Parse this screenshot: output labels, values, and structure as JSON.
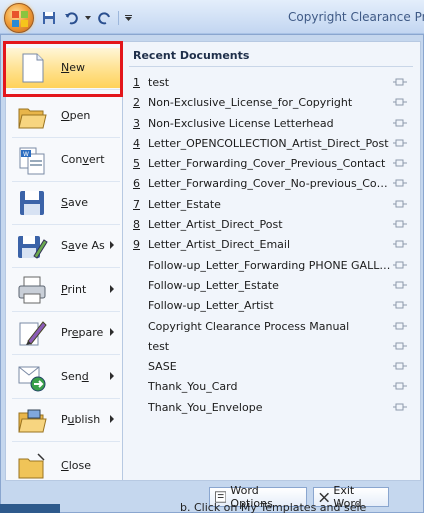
{
  "title_bar": {
    "title": "Copyright Clearance Pro"
  },
  "left_menu": {
    "items": [
      {
        "label": "New",
        "access": "N",
        "arrow": false,
        "icon": "new-document-icon"
      },
      {
        "label": "Open",
        "access": "O",
        "arrow": false,
        "icon": "open-folder-icon"
      },
      {
        "label": "Convert",
        "access": "v",
        "arrow": false,
        "icon": "convert-icon"
      },
      {
        "label": "Save",
        "access": "S",
        "arrow": false,
        "icon": "save-icon"
      },
      {
        "label": "Save As",
        "access": "A",
        "arrow": true,
        "icon": "save-as-icon"
      },
      {
        "label": "Print",
        "access": "P",
        "arrow": true,
        "icon": "printer-icon"
      },
      {
        "label": "Prepare",
        "access": "E",
        "arrow": true,
        "icon": "prepare-icon"
      },
      {
        "label": "Send",
        "access": "D",
        "arrow": true,
        "icon": "send-icon"
      },
      {
        "label": "Publish",
        "access": "U",
        "arrow": true,
        "icon": "publish-icon"
      },
      {
        "label": "Close",
        "access": "C",
        "arrow": false,
        "icon": "close-folder-icon"
      }
    ]
  },
  "recent": {
    "heading": "Recent Documents",
    "items": [
      {
        "num": "1",
        "name": "test"
      },
      {
        "num": "2",
        "name": "Non-Exclusive_License_for_Copyright"
      },
      {
        "num": "3",
        "name": "Non-Exclusive License Letterhead"
      },
      {
        "num": "4",
        "name": "Letter_OPENCOLLECTION_Artist_Direct_Post"
      },
      {
        "num": "5",
        "name": "Letter_Forwarding_Cover_Previous_Contact"
      },
      {
        "num": "6",
        "name": "Letter_Forwarding_Cover_No-previous_Contact"
      },
      {
        "num": "7",
        "name": "Letter_Estate"
      },
      {
        "num": "8",
        "name": "Letter_Artist_Direct_Post"
      },
      {
        "num": "9",
        "name": "Letter_Artist_Direct_Email"
      },
      {
        "num": "",
        "name": "Follow-up_Letter_Forwarding PHONE GALLERY..."
      },
      {
        "num": "",
        "name": "Follow-up_Letter_Estate"
      },
      {
        "num": "",
        "name": "Follow-up_Letter_Artist"
      },
      {
        "num": "",
        "name": "Copyright Clearance Process Manual"
      },
      {
        "num": "",
        "name": "test"
      },
      {
        "num": "",
        "name": "SASE"
      },
      {
        "num": "",
        "name": "Thank_You_Card"
      },
      {
        "num": "",
        "name": "Thank_You_Envelope"
      }
    ]
  },
  "footer": {
    "options_label": "Word Options",
    "exit_label": "Exit Word"
  },
  "background_text": "b.   Click on My Templates and sele"
}
